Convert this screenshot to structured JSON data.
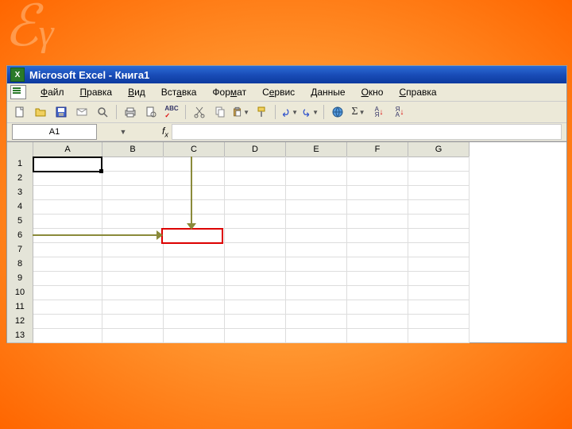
{
  "titlebar": {
    "title": "Microsoft Excel - Книга1"
  },
  "menu": {
    "file": "Файл",
    "edit": "Правка",
    "view": "Вид",
    "insert": "Вставка",
    "format": "Формат",
    "service": "Сервис",
    "data": "Данные",
    "window": "Окно",
    "help": "Справка"
  },
  "namebox": {
    "value": "A1",
    "fx": "fx"
  },
  "columns": [
    "A",
    "B",
    "C",
    "D",
    "E",
    "F",
    "G"
  ],
  "rows": [
    "1",
    "2",
    "3",
    "4",
    "5",
    "6",
    "7",
    "8",
    "9",
    "10",
    "11",
    "12",
    "13"
  ],
  "active_cell": "A1",
  "target_cell": "C6",
  "icons": {
    "new": "▱",
    "open": "open",
    "save": "save",
    "mail": "mail",
    "search": "search",
    "print": "print",
    "preview": "preview",
    "spell": "ABC",
    "cut": "cut",
    "copy": "copy",
    "paste": "paste",
    "fmtpaint": "brush",
    "undo": "undo",
    "redo": "redo",
    "web": "web",
    "sigma": "Σ",
    "sortaz": "A↓",
    "sortza": "Z↓"
  }
}
